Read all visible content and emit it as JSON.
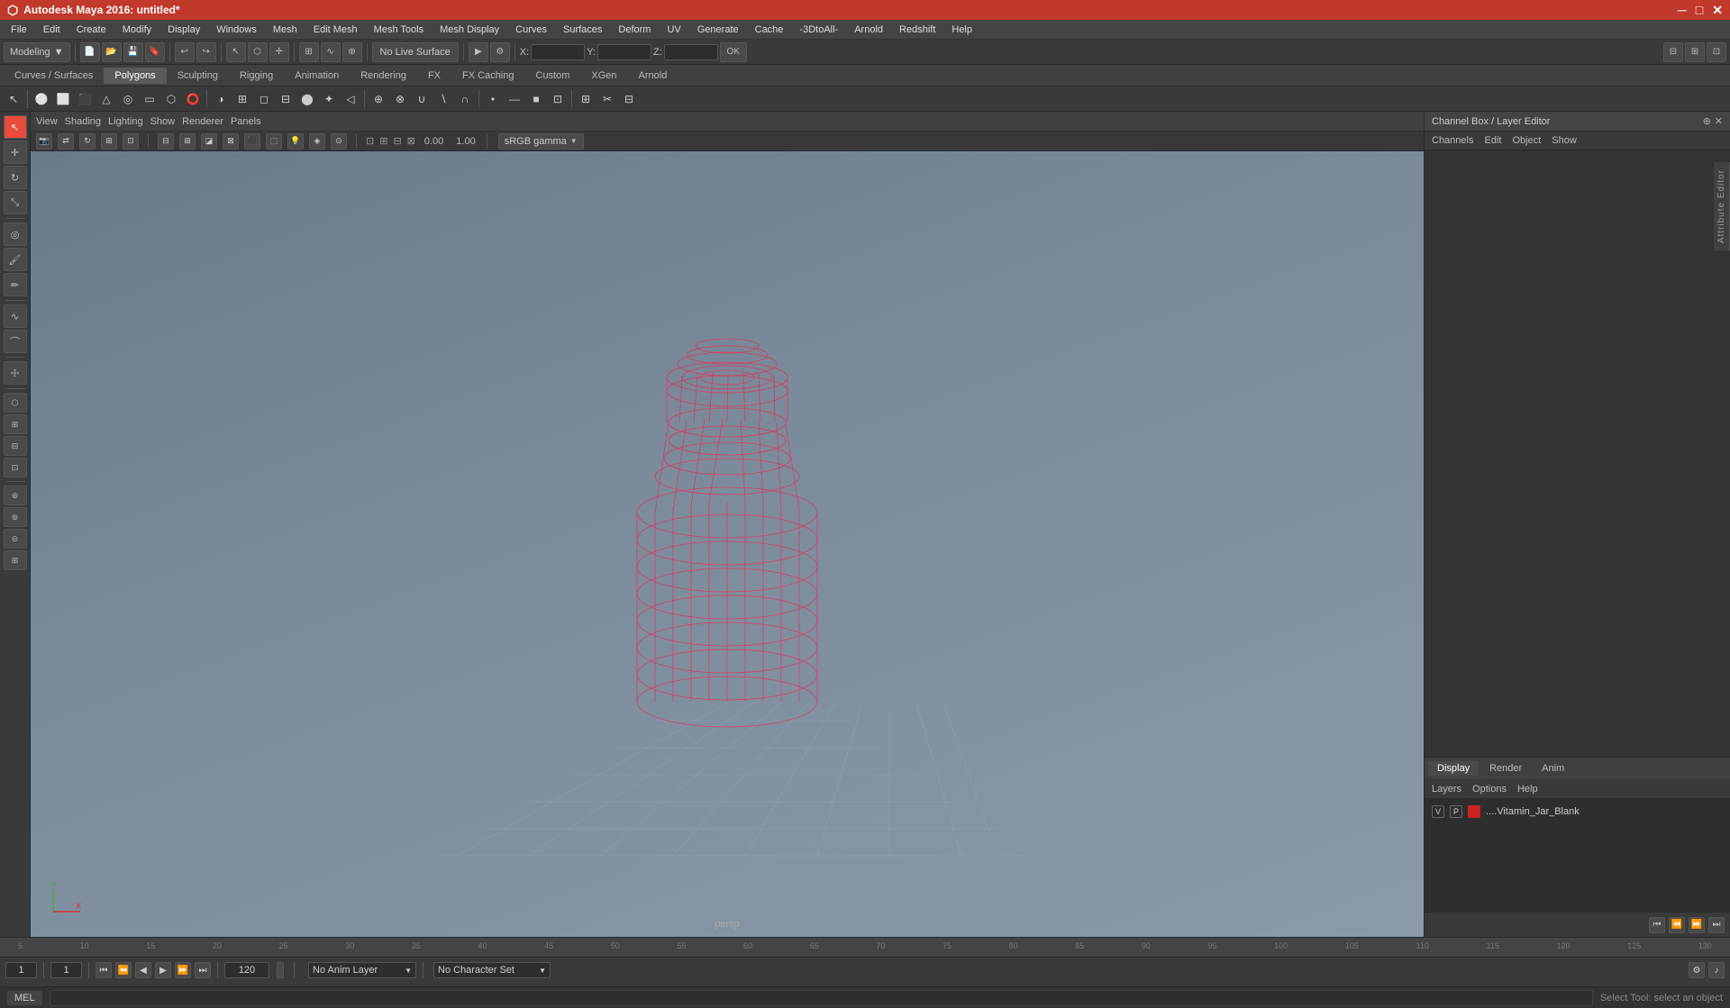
{
  "app": {
    "title": "Autodesk Maya 2016: untitled*",
    "window_controls": [
      "minimize",
      "maximize",
      "close"
    ]
  },
  "menu_bar": {
    "items": [
      "File",
      "Edit",
      "Create",
      "Modify",
      "Display",
      "Windows",
      "Mesh",
      "Edit Mesh",
      "Mesh Tools",
      "Mesh Display",
      "Curves",
      "Surfaces",
      "Deform",
      "UV",
      "Generate",
      "Cache",
      "-3DtoAll-",
      "Arnold",
      "Redshift",
      "Help"
    ]
  },
  "main_toolbar": {
    "mode_dropdown": "Modeling",
    "live_surface": "No Live Surface",
    "coord_x_label": "X:",
    "coord_y_label": "Y:",
    "coord_z_label": "Z:"
  },
  "secondary_tabs": {
    "items": [
      "Curves / Surfaces",
      "Polygons",
      "Sculpting",
      "Rigging",
      "Animation",
      "Rendering",
      "FX",
      "FX Caching",
      "Custom",
      "XGen",
      "Arnold"
    ],
    "active": "Polygons"
  },
  "viewport": {
    "menus": [
      "View",
      "Shading",
      "Lighting",
      "Show",
      "Renderer",
      "Panels"
    ],
    "label": "persp",
    "gamma_label": "sRGB gamma",
    "axes_label": "Y"
  },
  "channel_box": {
    "title": "Channel Box / Layer Editor",
    "menus": [
      "Channels",
      "Edit",
      "Object",
      "Show"
    ]
  },
  "layer_editor": {
    "tabs": [
      "Display",
      "Render",
      "Anim"
    ],
    "active_tab": "Display",
    "options": [
      "Layers",
      "Options",
      "Help"
    ],
    "layer": {
      "v": "V",
      "p": "P",
      "name": "....Vitamin_Jar_Blank",
      "color": "#cc2222"
    }
  },
  "timeline": {
    "start_frame": "1",
    "end_frame": "120",
    "current_frame": "1",
    "range_start": "1",
    "range_end": "120",
    "anim_layer": "No Anim Layer",
    "character_set": "No Character Set"
  },
  "status_bar": {
    "mode": "MEL",
    "message": "Select Tool: select an object"
  }
}
